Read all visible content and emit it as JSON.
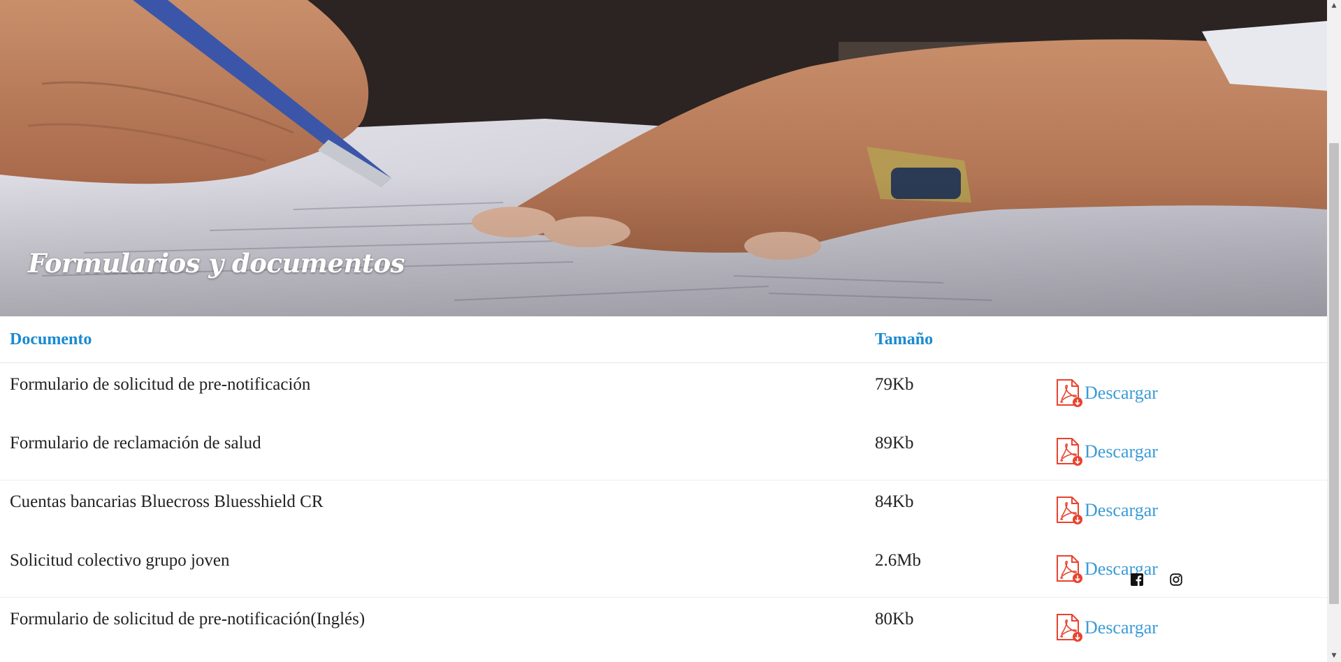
{
  "hero": {
    "title": "Formularios y documentos"
  },
  "table": {
    "headers": {
      "document": "Documento",
      "size": "Tamaño"
    },
    "download_label": "Descargar",
    "rows": [
      {
        "name": "Formulario de solicitud de pre-notificación",
        "size": "79Kb"
      },
      {
        "name": "Formulario de reclamación de salud",
        "size": "89Kb"
      },
      {
        "name": "Cuentas bancarias Bluecross Bluesshield CR",
        "size": "84Kb"
      },
      {
        "name": "Solicitud colectivo grupo joven",
        "size": "2.6Mb"
      },
      {
        "name": "Formulario de solicitud de pre-notificación(Inglés)",
        "size": "80Kb"
      }
    ]
  },
  "social": {
    "icons": [
      "facebook-icon",
      "instagram-icon"
    ]
  },
  "colors": {
    "header_text": "#1a8ad0",
    "link": "#3a9bd6",
    "pdf_icon": "#e8432f",
    "body_text": "#222222"
  }
}
